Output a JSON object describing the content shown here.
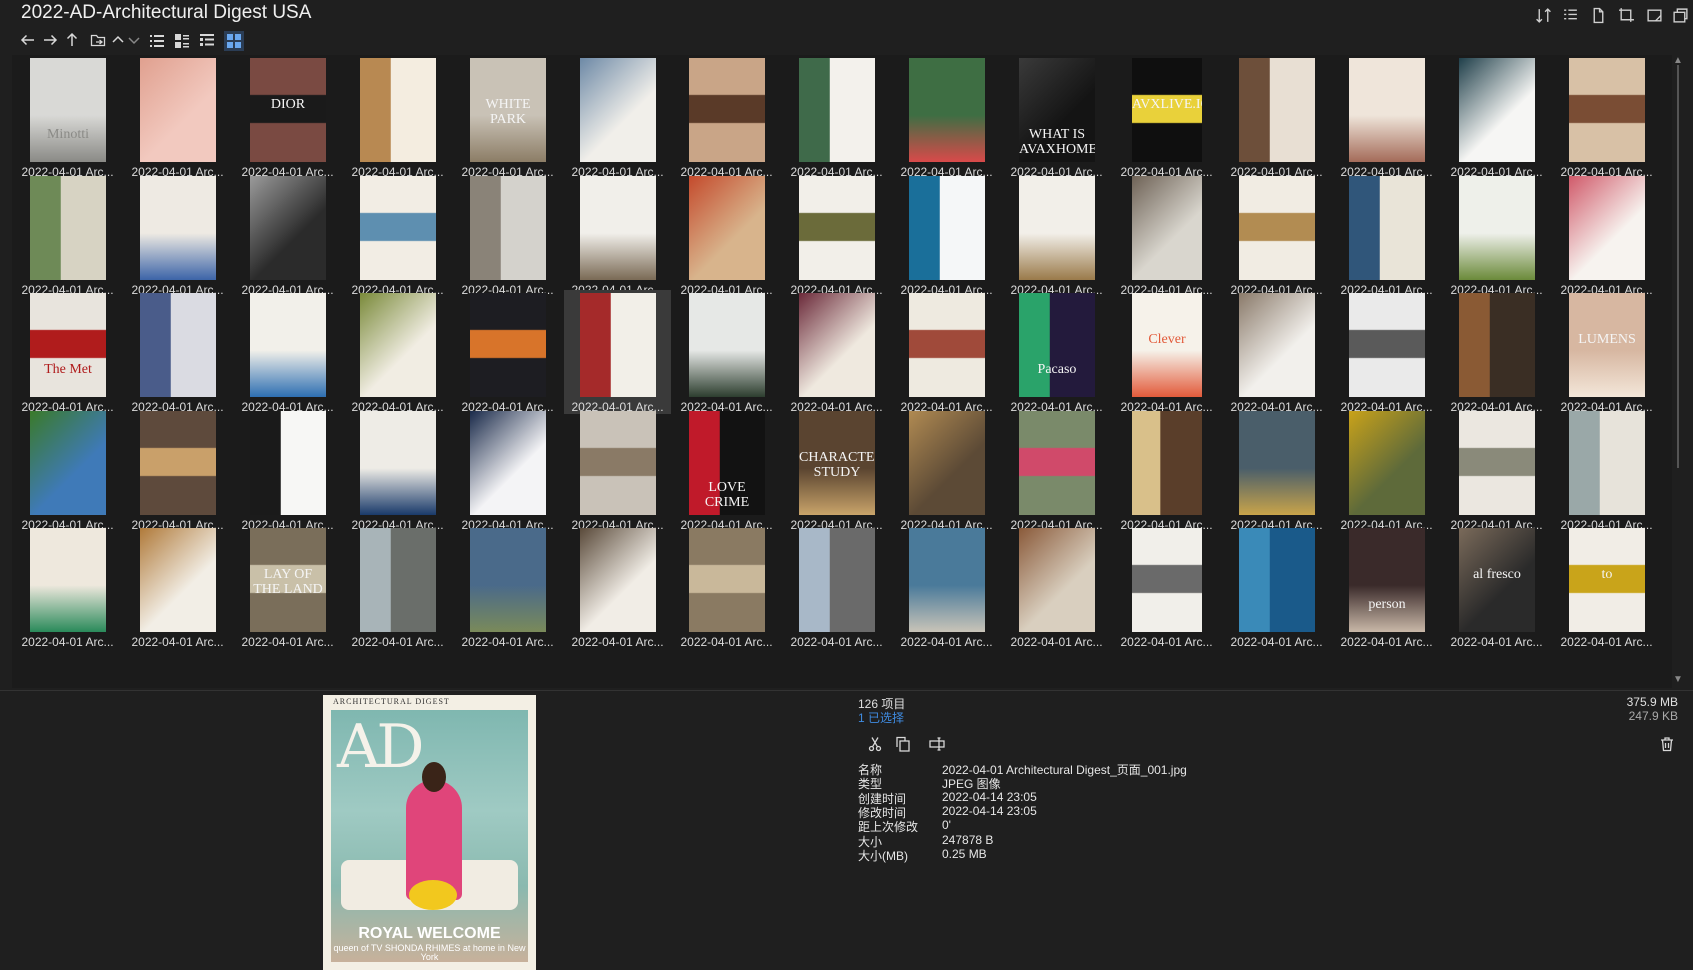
{
  "window": {
    "title": "2022-AD-Architectural Digest USA",
    "toolbar_icons": [
      "sort-icon",
      "details-list-icon",
      "new-file-icon",
      "crop-icon",
      "window-icon",
      "copy-window-icon"
    ]
  },
  "navigation": {
    "buttons": [
      "back-icon",
      "forward-icon",
      "up-icon",
      "folder-icon",
      "collapse-icon",
      "expand-icon"
    ],
    "views": [
      "list-view-icon",
      "details-view-icon",
      "tiles-view-icon",
      "thumbnail-view-icon"
    ],
    "active_view": "thumbnail-view-icon"
  },
  "thumbnails": {
    "caption": "2022-04-01 Arc...",
    "items": [
      {
        "bg": "#d9d9d6",
        "accent": "#8a8a86",
        "text": "Minotti"
      },
      {
        "bg": "#f2c9bf",
        "accent": "#e0a08f",
        "text": ""
      },
      {
        "bg": "#7a4a42",
        "accent": "#1a1a1a",
        "text": "DIOR"
      },
      {
        "bg": "#f4ede0",
        "accent": "#b88952",
        "text": ""
      },
      {
        "bg": "#c9c2b6",
        "accent": "#8c7d66",
        "text": "WHITE PARK"
      },
      {
        "bg": "#f1efea",
        "accent": "#6d89a6",
        "text": ""
      },
      {
        "bg": "#c9a587",
        "accent": "#5a3a28",
        "text": ""
      },
      {
        "bg": "#f3f1ec",
        "accent": "#3f6a4a",
        "text": ""
      },
      {
        "bg": "#3e6e43",
        "accent": "#d94a4a",
        "text": ""
      },
      {
        "bg": "#141414",
        "accent": "#3a3a3a",
        "text": "WHAT IS AVAXHOME?"
      },
      {
        "bg": "#0f0f0f",
        "accent": "#e9d13a",
        "text": "AVXLIVE.ICU"
      },
      {
        "bg": "#e8dfd3",
        "accent": "#6d4f3a",
        "text": ""
      },
      {
        "bg": "#efe5da",
        "accent": "#a46b59",
        "text": ""
      },
      {
        "bg": "#f6f6f4",
        "accent": "#1f3f4a",
        "text": ""
      },
      {
        "bg": "#d8c1a6",
        "accent": "#7a4d34",
        "text": ""
      },
      {
        "bg": "#d7d3c3",
        "accent": "#6e8a57",
        "text": ""
      },
      {
        "bg": "#eeeae3",
        "accent": "#3c64a8",
        "text": ""
      },
      {
        "bg": "#2b2b2b",
        "accent": "#9a9a9a",
        "text": ""
      },
      {
        "bg": "#f2ede4",
        "accent": "#5e8fb0",
        "text": ""
      },
      {
        "bg": "#d4d2cc",
        "accent": "#8a8378",
        "text": ""
      },
      {
        "bg": "#f1efea",
        "accent": "#7a6a55",
        "text": ""
      },
      {
        "bg": "#d8b48c",
        "accent": "#c44a2c",
        "text": ""
      },
      {
        "bg": "#f2efe9",
        "accent": "#6b6b3a",
        "text": ""
      },
      {
        "bg": "#f5f7f8",
        "accent": "#1a6f9a",
        "text": ""
      },
      {
        "bg": "#f2efe9",
        "accent": "#9a7a4a",
        "text": ""
      },
      {
        "bg": "#d9d6ce",
        "accent": "#6e6256",
        "text": ""
      },
      {
        "bg": "#f1ece3",
        "accent": "#b28c52",
        "text": ""
      },
      {
        "bg": "#e9e4d8",
        "accent": "#30567a",
        "text": ""
      },
      {
        "bg": "#eef0ea",
        "accent": "#6b8a3a",
        "text": ""
      },
      {
        "bg": "#f7f3ef",
        "accent": "#d05a6a",
        "text": ""
      },
      {
        "bg": "#e8e4dd",
        "accent": "#b01c1c",
        "text": "The Met"
      },
      {
        "bg": "#dadbe2",
        "accent": "#4a5c8a",
        "text": ""
      },
      {
        "bg": "#f2f0ea",
        "accent": "#2e6fb2",
        "text": ""
      },
      {
        "bg": "#f1ede3",
        "accent": "#7a8a3a",
        "text": ""
      },
      {
        "bg": "#1d1d22",
        "accent": "#d8742a",
        "text": ""
      },
      {
        "bg": "#f2efe8",
        "accent": "#a52a2a",
        "text": ""
      },
      {
        "bg": "#e6e8e6",
        "accent": "#2d3e2f",
        "text": ""
      },
      {
        "bg": "#efe9df",
        "accent": "#6b2a3a",
        "text": ""
      },
      {
        "bg": "#eeeae0",
        "accent": "#a04a3a",
        "text": ""
      },
      {
        "bg": "#231a3c",
        "accent": "#2aa36a",
        "text": "Pacaso"
      },
      {
        "bg": "#f6f2ea",
        "accent": "#e25a3a",
        "text": "Clever"
      },
      {
        "bg": "#f2f0ec",
        "accent": "#8a7a6a",
        "text": ""
      },
      {
        "bg": "#eaeaea",
        "accent": "#5a5a5a",
        "text": ""
      },
      {
        "bg": "#3a2e24",
        "accent": "#8a5a34",
        "text": ""
      },
      {
        "bg": "#d7b7a1",
        "accent": "#f3e6d9",
        "text": "LUMENS"
      },
      {
        "bg": "#3f7ab8",
        "accent": "#3a7a2a",
        "text": ""
      },
      {
        "bg": "#5e4a3c",
        "accent": "#c9a06a",
        "text": ""
      },
      {
        "bg": "#f7f7f5",
        "accent": "#1a1a1a",
        "text": ""
      },
      {
        "bg": "#eeece6",
        "accent": "#1a3a6a",
        "text": ""
      },
      {
        "bg": "#f4f4f6",
        "accent": "#1a2a4a",
        "text": ""
      },
      {
        "bg": "#c9c2b8",
        "accent": "#8a7a66",
        "text": ""
      },
      {
        "bg": "#121212",
        "accent": "#c01a2a",
        "text": "LOVE CRIME"
      },
      {
        "bg": "#5a4430",
        "accent": "#c9a46a",
        "text": "CHARACTER STUDY"
      },
      {
        "bg": "#5c4a36",
        "accent": "#b08a52",
        "text": ""
      },
      {
        "bg": "#7a8a6a",
        "accent": "#d04a6a",
        "text": ""
      },
      {
        "bg": "#5a3e2a",
        "accent": "#d9c08a",
        "text": ""
      },
      {
        "bg": "#4a5e6a",
        "accent": "#c9a44a",
        "text": ""
      },
      {
        "bg": "#5e6a3a",
        "accent": "#c9a21a",
        "text": ""
      },
      {
        "bg": "#ebe7e0",
        "accent": "#8a8a7a",
        "text": ""
      },
      {
        "bg": "#e7e3da",
        "accent": "#9aa8a8",
        "text": ""
      },
      {
        "bg": "#eee8dd",
        "accent": "#2a8a5a",
        "text": ""
      },
      {
        "bg": "#f2eee6",
        "accent": "#b07a3a",
        "text": ""
      },
      {
        "bg": "#7a6e5a",
        "accent": "#c9c0a8",
        "text": "LAY OF THE LAND"
      },
      {
        "bg": "#6a6e6a",
        "accent": "#a8b4b8",
        "text": ""
      },
      {
        "bg": "#4a6a8a",
        "accent": "#7a8a5a",
        "text": ""
      },
      {
        "bg": "#f1ede6",
        "accent": "#5a4a3a",
        "text": ""
      },
      {
        "bg": "#8a7a62",
        "accent": "#c9b89a",
        "text": ""
      },
      {
        "bg": "#6a6a6a",
        "accent": "#a8b8c8",
        "text": ""
      },
      {
        "bg": "#4a7a9a",
        "accent": "#c9c4b8",
        "text": ""
      },
      {
        "bg": "#d9cfbf",
        "accent": "#8a5a3a",
        "text": ""
      },
      {
        "bg": "#f1efea",
        "accent": "#6a6a6a",
        "text": ""
      },
      {
        "bg": "#1a5a8a",
        "accent": "#3a8ab8",
        "text": ""
      },
      {
        "bg": "#3a2a2a",
        "accent": "#c9b8a8",
        "text": "person"
      },
      {
        "bg": "#2a2a2a",
        "accent": "#7a6a5a",
        "text": "al fresco"
      },
      {
        "bg": "#f1ede6",
        "accent": "#c9a41a",
        "text": "to"
      }
    ]
  },
  "preview": {
    "masthead": "ARCHITECTURAL DIGEST",
    "logo": "AD",
    "headline": "ROYAL WELCOME",
    "subline": "queen of TV SHONDA RHIMES at home in New York"
  },
  "info": {
    "item_count": "126 项目",
    "selected_count": "1 已选择",
    "total_size": "375.9 MB",
    "selected_size": "247.9 KB",
    "actions": [
      "cut-icon",
      "copy-icon",
      "rename-icon"
    ],
    "properties": [
      {
        "key": "名称",
        "value": "2022-04-01 Architectural Digest_页面_001.jpg"
      },
      {
        "key": "类型",
        "value": "JPEG 图像"
      },
      {
        "key": "创建时间",
        "value": "2022-04-14  23:05"
      },
      {
        "key": "修改时间",
        "value": "2022-04-14  23:05"
      },
      {
        "key": "距上次修改",
        "value": "0'"
      },
      {
        "key": "大小",
        "value": "247878 B"
      },
      {
        "key": "大小(MB)",
        "value": "0.25 MB"
      }
    ]
  }
}
